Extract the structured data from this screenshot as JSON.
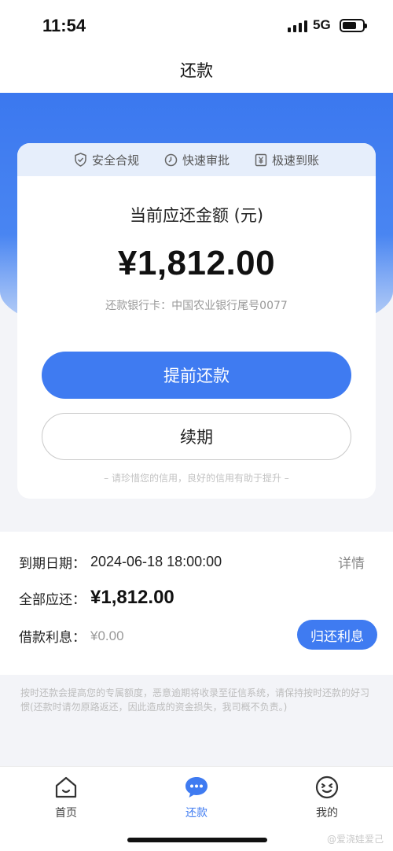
{
  "status": {
    "time": "11:54",
    "network": "5G"
  },
  "nav": {
    "title": "还款"
  },
  "badges": [
    {
      "label": "安全合规",
      "icon": "shield-check-icon"
    },
    {
      "label": "快速审批",
      "icon": "clock-icon"
    },
    {
      "label": "极速到账",
      "icon": "yen-receipt-icon"
    }
  ],
  "card": {
    "title": "当前应还金额 (元)",
    "amount": "¥1,812.00",
    "bank_card": "还款银行卡：中国农业银行尾号0077",
    "primary_button": "提前还款",
    "secondary_button": "续期",
    "tip": "– 请珍惜您的信用，良好的信用有助于提升 –"
  },
  "details": {
    "due_label": "到期日期：",
    "due_value": "2024-06-18 18:00:00",
    "detail_link": "详情",
    "total_label": "全部应还：",
    "total_value": "¥1,812.00",
    "interest_label": "借款利息：",
    "interest_value": "¥0.00",
    "interest_button": "归还利息"
  },
  "notice": "按时还款会提高您的专属额度，恶意逾期将收录至征信系统，请保持按时还款的好习惯(还款时请勿原路返还，因此造成的资金损失，我司概不负责。)",
  "tabs": [
    {
      "label": "首页",
      "icon": "home-icon",
      "active": false
    },
    {
      "label": "还款",
      "icon": "chat-bubble-icon",
      "active": true
    },
    {
      "label": "我的",
      "icon": "smiley-face-icon",
      "active": false
    }
  ],
  "watermark": "@爱浇娃爱己",
  "colors": {
    "accent": "#3f7bf1",
    "header_blue": "#3b78ef"
  }
}
